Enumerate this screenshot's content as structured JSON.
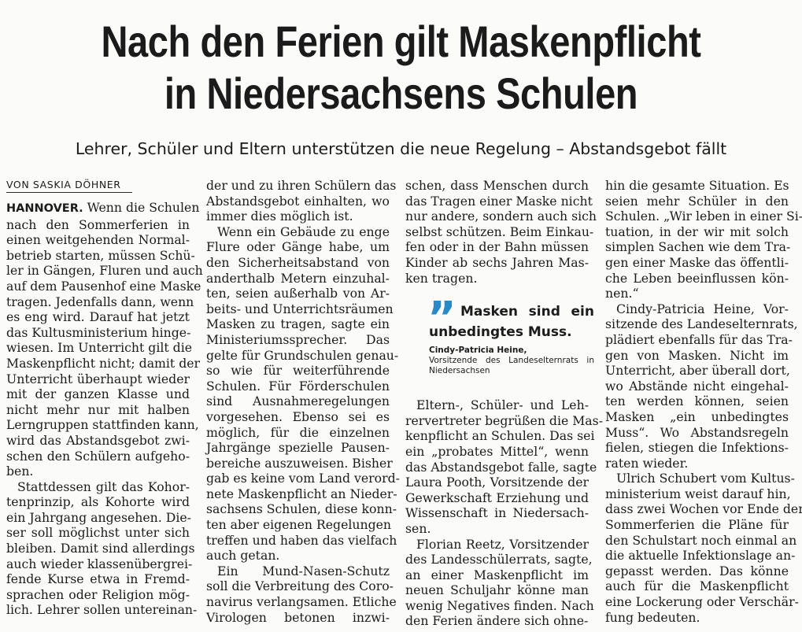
{
  "headline": {
    "line1": "Nach den Ferien gilt Maskenpflicht",
    "line2": "in Niedersachsens Schulen"
  },
  "subheadline": "Lehrer, Schüler und Eltern unterstützen die neue Regelung – Abstandsgebot fällt",
  "byline": "VON SASKIA DÖHNER",
  "dateline": "HANNOVER.",
  "columns": {
    "col1": [
      " Wenn die Schulen",
      "nach den Sommerferien in",
      "einen weitgehenden Normal-",
      "betrieb starten, müssen Schü-",
      "ler in Gängen, Fluren und auch",
      "auf dem Pausenhof eine Maske",
      "tragen. Jedenfalls dann, wenn",
      "es eng wird. Darauf hat jetzt",
      "das Kultusministerium hinge-",
      "wiesen. Im Unterricht gilt die",
      "Maskenpflicht nicht; damit der",
      "Unterricht überhaupt wieder",
      "mit der ganzen Klasse und",
      "nicht mehr nur mit halben",
      "Lerngruppen stattfinden kann,",
      "wird das Abstandsgebot zwi-",
      "schen den Schülern aufgeho-",
      "ben.",
      "Stattdessen gilt das Kohor-",
      "tenprinzip, als Kohorte wird",
      "ein Jahrgang angesehen. Die-",
      "ser soll möglichst unter sich",
      "bleiben. Damit sind allerdings",
      "auch wieder klassenübergrei-",
      "fende Kurse etwa in Fremd-",
      "sprachen oder Religion mög-",
      "lich. Lehrer sollen untereinan-"
    ],
    "col2": [
      "der und zu ihren Schülern das",
      "Abstandsgebot einhalten, wo",
      "immer dies möglich ist.",
      "Wenn ein Gebäude zu enge",
      "Flure oder Gänge habe, um",
      "den Sicherheitsabstand von",
      "anderthalb Metern einzuhal-",
      "ten, seien außerhalb von Ar-",
      "beits- und Unterrichtsräumen",
      "Masken zu tragen, sagte ein",
      "Ministeriumssprecher. Das",
      "gelte für Grundschulen genau-",
      "so wie für weiterführende",
      "Schulen. Für Förderschulen",
      "sind Ausnahmeregelungen",
      "vorgesehen. Ebenso sei es",
      "möglich, für die einzelnen",
      "Jahrgänge spezielle Pausen-",
      "bereiche auszuweisen. Bisher",
      "gab es keine vom Land verord-",
      "nete Maskenpflicht an Nieder-",
      "sachsens Schulen, diese konn-",
      "ten aber eigenen Regelungen",
      "treffen und haben das vielfach",
      "auch getan.",
      "Ein Mund-Nasen-Schutz",
      "soll die Verbreitung des Coro-",
      "navirus verlangsamen. Etliche",
      "Virologen betonen inzwi-"
    ],
    "col3_top": [
      "schen, dass Menschen durch",
      "das Tragen einer Maske nicht",
      "nur andere, sondern auch sich",
      "selbst schützen. Beim Einkau-",
      "fen oder in der Bahn müssen",
      "Kinder ab sechs Jahren Mas-",
      "ken tragen."
    ],
    "col3_bottom": [
      "Eltern-, Schüler- und Leh-",
      "rervertreter begrüßen die Mas-",
      "kenpflicht an Schulen. Das sei",
      "ein „probates Mittel“, wenn",
      "das Abstandsgebot falle, sagte",
      "Laura Pooth, Vorsitzende der",
      "Gewerkschaft Erziehung und",
      "Wissenschaft in Niedersach-",
      "sen.",
      "Florian Reetz, Vorsitzender",
      "des Landesschülerrats, sagte,",
      "an einer Maskenpflicht im",
      "neuen Schuljahr könne man",
      "wenig Negatives finden. Nach",
      "den Ferien ändere sich ohne-"
    ],
    "col4": [
      "hin die gesamte Situation. Es",
      "seien mehr Schüler in den",
      "Schulen. „Wir leben in einer Si-",
      "tuation, in der wir mit solch",
      "simplen Sachen wie dem Tra-",
      "gen einer Maske das öffentli-",
      "che Leben beeinflussen kön-",
      "nen.“",
      "Cindy-Patricia Heine, Vor-",
      "sitzende des Landeselternrats,",
      "plädiert ebenfalls für das Tra-",
      "gen von Masken. Nicht im",
      "Unterricht, aber überall dort,",
      "wo Abstände nicht eingehal-",
      "ten werden können, seien",
      "Masken „ein unbedingtes",
      "Muss“. Wo Abstandsregeln",
      "fielen, stiegen die Infektions-",
      "raten wieder.",
      "Ulrich Schubert vom Kultus-",
      "ministerium weist darauf hin,",
      "dass zwei Wochen vor Ende der",
      "Sommerferien die Pläne für",
      "den Schulstart noch einmal an",
      "die aktuelle Infektionslage an-",
      "gepasst werden. Das könne",
      "auch für die Maskenpflicht",
      "eine Lockerung oder Verschär-",
      "fung bedeuten."
    ]
  },
  "pull_quote": {
    "mark": "”",
    "text": "Masken sind ein unbedingtes Muss.",
    "author_name": "Cindy-Patricia Heine,",
    "author_role": "Vorsitzende des Landeselternrats in Niedersachsen"
  },
  "colors": {
    "text": "#1b1b1b",
    "quote_accent": "#2a8ac8",
    "background": "#fbfbf9"
  }
}
